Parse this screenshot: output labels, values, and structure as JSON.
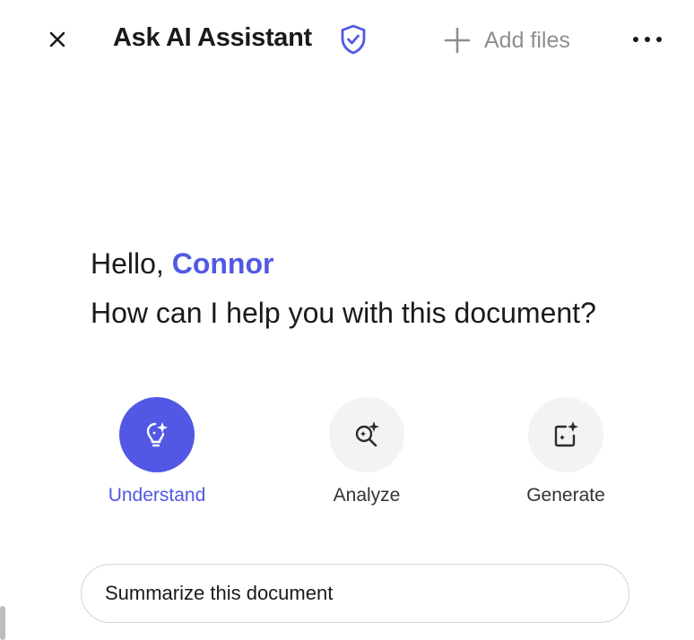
{
  "header": {
    "title": "Ask AI Assistant",
    "add_files_label": "Add files",
    "close_icon": "close-icon",
    "shield_icon": "shield-check-icon",
    "more_icon": "more-horizontal-icon"
  },
  "greeting": {
    "hello": "Hello, ",
    "name": "Connor",
    "question": "How can I help you with this document?"
  },
  "actions": [
    {
      "label": "Understand",
      "icon": "lightbulb-sparkle-icon",
      "active": true
    },
    {
      "label": "Analyze",
      "icon": "magnify-sparkle-icon",
      "active": false
    },
    {
      "label": "Generate",
      "icon": "create-sparkle-icon",
      "active": false
    }
  ],
  "suggestion": {
    "label": "Summarize this document"
  },
  "colors": {
    "accent": "#5258e4",
    "muted": "#8e8e8e",
    "circle_bg": "#f3f3f3"
  }
}
